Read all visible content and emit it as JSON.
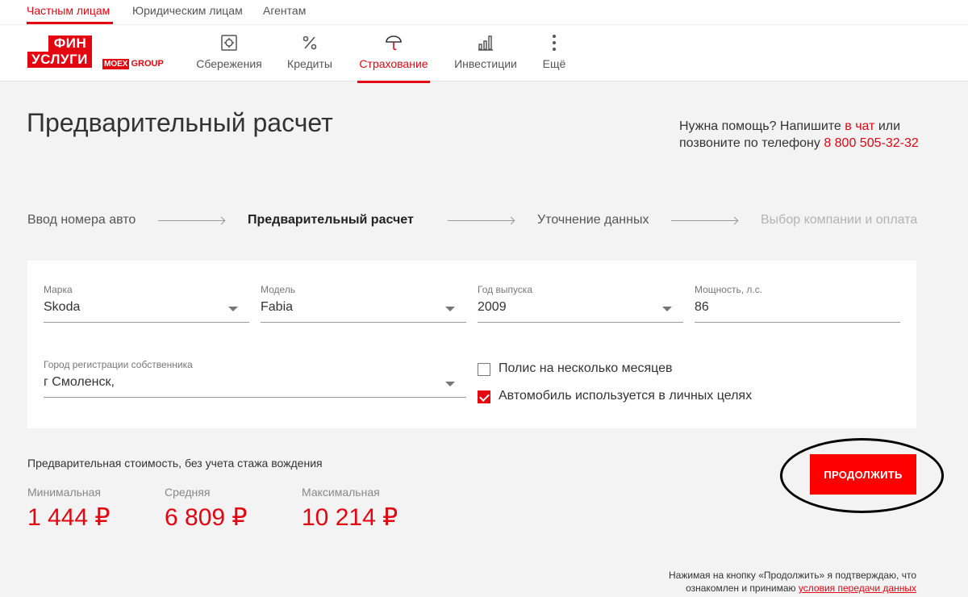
{
  "audience_tabs": [
    "Частным лицам",
    "Юридическим лицам",
    "Агентам"
  ],
  "logo": {
    "line1": "ФИН",
    "line2": "УСЛУГИ",
    "moex_box": "MOEX",
    "moex_text": "GROUP"
  },
  "nav": [
    {
      "label": "Сбережения",
      "icon": "savings-icon"
    },
    {
      "label": "Кредиты",
      "icon": "percent-icon"
    },
    {
      "label": "Страхование",
      "icon": "umbrella-icon"
    },
    {
      "label": "Инвестиции",
      "icon": "investments-icon"
    },
    {
      "label": "Ещё",
      "icon": "more-vertical-icon"
    }
  ],
  "page_title": "Предварительный расчет",
  "help": {
    "part1": "Нужна помощь? Напишите ",
    "chat_link": "в чат",
    "part2": " или позвоните по телефону ",
    "phone": "8 800 505-32-32"
  },
  "steps": [
    "Ввод номера авто",
    "Предварительный расчет",
    "Уточнение данных",
    "Выбор компании и оплата"
  ],
  "form": {
    "brand": {
      "label": "Марка",
      "value": "Skoda"
    },
    "model": {
      "label": "Модель",
      "value": "Fabia"
    },
    "year": {
      "label": "Год выпуска",
      "value": "2009"
    },
    "power": {
      "label": "Мощность, л.с.",
      "value": "86"
    },
    "city": {
      "label": "Город регистрации собственника",
      "value": "г Смоленск,"
    },
    "multi_month": {
      "label": "Полис на несколько месяцев",
      "checked": false
    },
    "personal_use": {
      "label": "Автомобиль используется в личных целях",
      "checked": true
    }
  },
  "price": {
    "caption": "Предварительная стоимость, без учета стажа вождения",
    "min": {
      "label": "Минимальная",
      "value": "1 444 ₽"
    },
    "avg": {
      "label": "Средняя",
      "value": "6 809 ₽"
    },
    "max": {
      "label": "Максимальная",
      "value": "10 214 ₽"
    }
  },
  "continue_label": "ПРОДОЛЖИТЬ",
  "consent": {
    "line1": "Нажимая на кнопку «Продолжить» я подтверждаю, что",
    "line2": "ознакомлен и принимаю ",
    "link": "условия передачи данных"
  },
  "colors": {
    "accent": "#e30611",
    "button": "#ff0000",
    "background": "#f3f3f3"
  }
}
